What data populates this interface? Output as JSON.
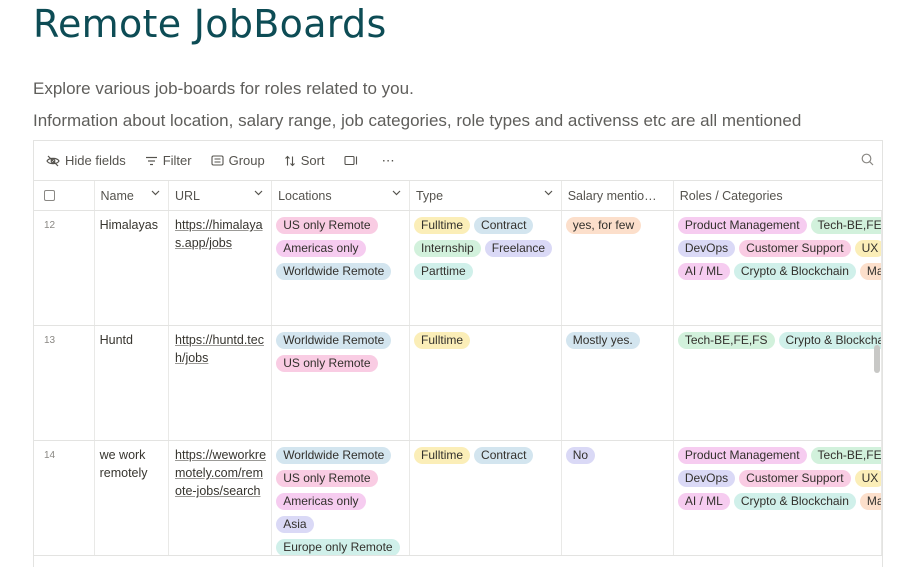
{
  "page": {
    "title": "Remote JobBoards",
    "desc1": "Explore various job-boards for roles related to you.",
    "desc2": "Information about location, salary range, job categories, role types and activenss etc are all mentioned"
  },
  "toolbar": {
    "hide_fields": "Hide fields",
    "filter": "Filter",
    "group": "Group",
    "sort": "Sort",
    "more": "⋯"
  },
  "columns": [
    "Name",
    "URL",
    "Locations",
    "Type",
    "Salary mentio…",
    "Roles / Categories"
  ],
  "colors": {
    "pink": "#f9cce3",
    "blue": "#d3e5ef",
    "yellow": "#fbeeb8",
    "green": "#d2f1dc",
    "purple": "#dad9f6",
    "orange": "#fcdfcb",
    "teal": "#d0f0ea",
    "magenta": "#f6ccf0"
  },
  "rows": [
    {
      "id": "12",
      "name": "Himalayas",
      "url": "https://himalayas.app/jobs",
      "locations": [
        {
          "label": "US only Remote",
          "color": "#f9cce3"
        },
        {
          "label": "Americas only",
          "color": "#f6ccf0"
        },
        {
          "label": "Worldwide Remote",
          "color": "#d3e5ef"
        }
      ],
      "types": [
        {
          "label": "Fulltime",
          "color": "#fbeeb8"
        },
        {
          "label": "Contract",
          "color": "#d3e5ef"
        },
        {
          "label": "Internship",
          "color": "#d2f1dc"
        },
        {
          "label": "Freelance",
          "color": "#dad9f6"
        },
        {
          "label": "Parttime",
          "color": "#d0f0ea"
        }
      ],
      "salary": [
        {
          "label": "yes, for few",
          "color": "#fcdfcb"
        }
      ],
      "roles": [
        {
          "label": "Product Management",
          "color": "#f6ccf0"
        },
        {
          "label": "Tech-BE,FE,FS",
          "color": "#d2f1dc"
        },
        {
          "label": "DevOps",
          "color": "#dad9f6"
        },
        {
          "label": "Customer Support",
          "color": "#f9cce3"
        },
        {
          "label": "UX",
          "color": "#fbeeb8"
        },
        {
          "label": "AI / ML",
          "color": "#f6ccf0"
        },
        {
          "label": "Crypto & Blockchain",
          "color": "#d0f0ea"
        },
        {
          "label": "Ma",
          "color": "#fcdfcb"
        }
      ]
    },
    {
      "id": "13",
      "name": "Huntd",
      "url": "https://huntd.tech/jobs",
      "locations": [
        {
          "label": "Worldwide Remote",
          "color": "#d3e5ef"
        },
        {
          "label": "US only Remote",
          "color": "#f9cce3"
        }
      ],
      "types": [
        {
          "label": "Fulltime",
          "color": "#fbeeb8"
        }
      ],
      "salary": [
        {
          "label": "Mostly yes.",
          "color": "#d3e5ef"
        }
      ],
      "roles": [
        {
          "label": "Tech-BE,FE,FS",
          "color": "#d2f1dc"
        },
        {
          "label": "Crypto & Blockchain",
          "color": "#d0f0ea"
        }
      ]
    },
    {
      "id": "14",
      "name": "we work remotely",
      "url": "https://weworkremotely.com/remote-jobs/search",
      "locations": [
        {
          "label": "Worldwide Remote",
          "color": "#d3e5ef"
        },
        {
          "label": "US only Remote",
          "color": "#f9cce3"
        },
        {
          "label": "Americas only",
          "color": "#f6ccf0"
        },
        {
          "label": "Asia",
          "color": "#dad9f6"
        },
        {
          "label": "Europe only Remote",
          "color": "#d0f0ea"
        }
      ],
      "types": [
        {
          "label": "Fulltime",
          "color": "#fbeeb8"
        },
        {
          "label": "Contract",
          "color": "#d3e5ef"
        }
      ],
      "salary": [
        {
          "label": "No",
          "color": "#dad9f6"
        }
      ],
      "roles": [
        {
          "label": "Product Management",
          "color": "#f6ccf0"
        },
        {
          "label": "Tech-BE,FE,FS",
          "color": "#d2f1dc"
        },
        {
          "label": "DevOps",
          "color": "#dad9f6"
        },
        {
          "label": "Customer Support",
          "color": "#f9cce3"
        },
        {
          "label": "UX",
          "color": "#fbeeb8"
        },
        {
          "label": "AI / ML",
          "color": "#f6ccf0"
        },
        {
          "label": "Crypto & Blockchain",
          "color": "#d0f0ea"
        },
        {
          "label": "Ma",
          "color": "#fcdfcb"
        }
      ]
    }
  ]
}
